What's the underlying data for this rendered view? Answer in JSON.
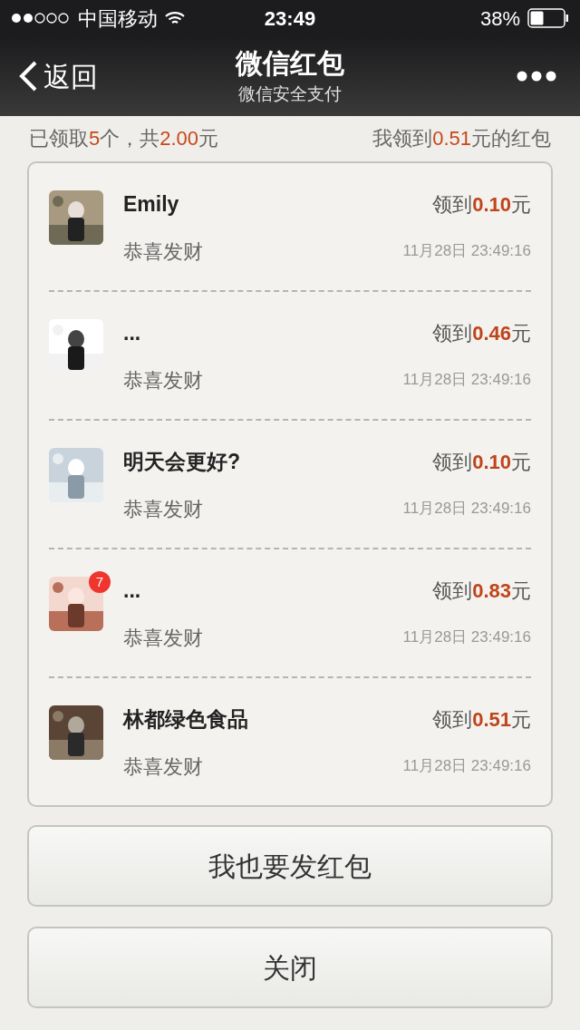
{
  "status_bar": {
    "carrier": "中国移动",
    "time": "23:49",
    "battery": "38%"
  },
  "nav": {
    "back": "返回",
    "title": "微信红包",
    "subtitle": "微信安全支付"
  },
  "summary": {
    "left": "已领取**5**个，共**2.00**元",
    "right": "我领到**0.51**元的红包"
  },
  "records": [
    {
      "name": "Emily",
      "amount": "领到**0.10**元",
      "wish": "恭喜发财",
      "time": "11月28日 23:49:16"
    },
    {
      "name": "...",
      "amount": "领到**0.46**元",
      "wish": "恭喜发财",
      "time": "11月28日 23:49:16"
    },
    {
      "name": "明天会更好?",
      "amount": "领到**0.10**元",
      "wish": "恭喜发财",
      "time": "11月28日 23:49:16"
    },
    {
      "name": "...",
      "amount": "领到**0.83**元",
      "wish": "恭喜发财",
      "time": "11月28日 23:49:16",
      "badge": "7"
    },
    {
      "name": "林都绿色食品",
      "amount": "领到**0.51**元",
      "wish": "恭喜发财",
      "time": "11月28日 23:49:16"
    }
  ],
  "buttons": [
    "我也要发红包",
    "关闭"
  ]
}
